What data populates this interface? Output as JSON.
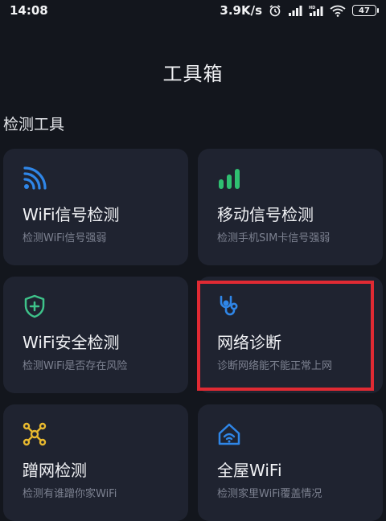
{
  "status_bar": {
    "time": "14:08",
    "net_speed": "3.9K/s",
    "battery": "47",
    "icons": [
      "alarm-icon",
      "signal-icon",
      "hd-signal-icon",
      "wifi-icon",
      "battery-icon"
    ]
  },
  "header": {
    "title": "工具箱"
  },
  "section": {
    "title": "检测工具"
  },
  "cards": [
    {
      "title": "WiFi信号检测",
      "subtitle": "检测WiFi信号强弱",
      "icon": "wifi-signal-icon",
      "icon_color": "#2f86e8"
    },
    {
      "title": "移动信号检测",
      "subtitle": "检测手机SIM卡信号强弱",
      "icon": "cellular-bars-icon",
      "icon_color": "#2fbf71"
    },
    {
      "title": "WiFi安全检测",
      "subtitle": "检测WiFi是否存在风险",
      "icon": "shield-plus-icon",
      "icon_color": "#3ec38a"
    },
    {
      "title": "网络诊断",
      "subtitle": "诊断网络能不能正常上网",
      "icon": "stethoscope-icon",
      "icon_color": "#2f86e8"
    },
    {
      "title": "蹭网检测",
      "subtitle": "检测有谁蹭你家WiFi",
      "icon": "network-nodes-icon",
      "icon_color": "#e8b92f"
    },
    {
      "title": "全屋WiFi",
      "subtitle": "检测家里WiFi覆盖情况",
      "icon": "home-wifi-icon",
      "icon_color": "#2f86e8"
    }
  ],
  "highlight_color": "#e02a33"
}
